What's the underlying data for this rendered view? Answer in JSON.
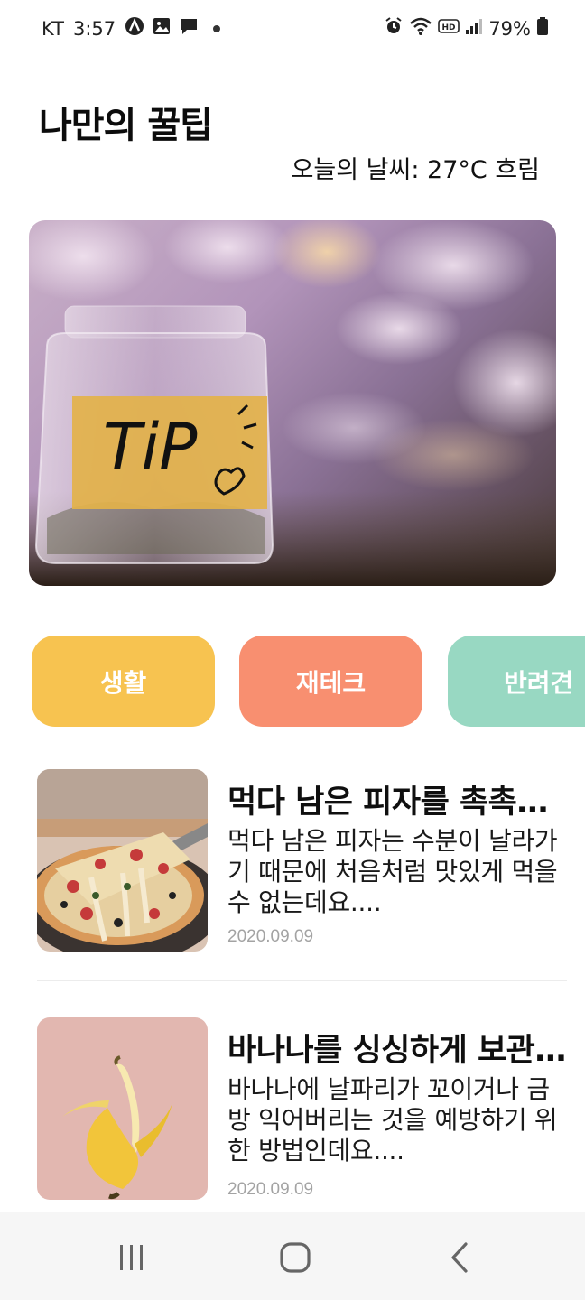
{
  "status_bar": {
    "carrier": "KT",
    "time": "3:57",
    "battery": "79%"
  },
  "header": {
    "title": "나만의 꿀팁",
    "weather": "오늘의 날씨: 27°C 흐림"
  },
  "hero": {
    "label_text": "TiP"
  },
  "categories": [
    {
      "label": "생활",
      "color": "#f7c350"
    },
    {
      "label": "재테크",
      "color": "#f88f70"
    },
    {
      "label": "반려견",
      "color": "#98d8c2"
    }
  ],
  "articles": [
    {
      "title": "먹다 남은 피자를 촉촉하게",
      "body": "먹다 남은 피자는 수분이 날라가기 때문에 처음처럼 맛있게 먹을 수 없는데요....",
      "date": "2020.09.09"
    },
    {
      "title": "바나나를 싱싱하게 보관하기",
      "body": "바나나에 날파리가 꼬이거나 금방 익어버리는 것을 예방하기 위한 방법인데요....",
      "date": "2020.09.09"
    }
  ]
}
